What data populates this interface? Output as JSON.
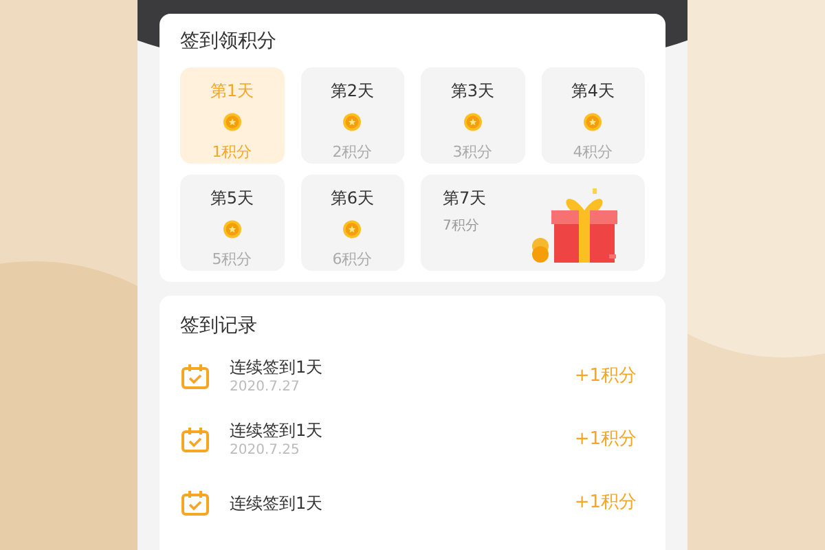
{
  "checkin": {
    "title": "签到领积分",
    "days": [
      {
        "kind": "coin",
        "label": "第1天",
        "points": "1积分",
        "selected": true
      },
      {
        "kind": "coin",
        "label": "第2天",
        "points": "2积分",
        "selected": false
      },
      {
        "kind": "coin",
        "label": "第3天",
        "points": "3积分",
        "selected": false
      },
      {
        "kind": "coin",
        "label": "第4天",
        "points": "4积分",
        "selected": false
      },
      {
        "kind": "coin",
        "label": "第5天",
        "points": "5积分",
        "selected": false
      },
      {
        "kind": "coin",
        "label": "第6天",
        "points": "6积分",
        "selected": false
      },
      {
        "kind": "gift",
        "label": "第7天",
        "points": "7积分",
        "selected": false
      }
    ]
  },
  "records": {
    "title": "签到记录",
    "items": [
      {
        "title": "连续签到1天",
        "date": "2020.7.27",
        "reward": "+1积分"
      },
      {
        "title": "连续签到1天",
        "date": "2020.7.25",
        "reward": "+1积分"
      },
      {
        "title": "连续签到1天",
        "reward": "+1积分"
      }
    ]
  }
}
